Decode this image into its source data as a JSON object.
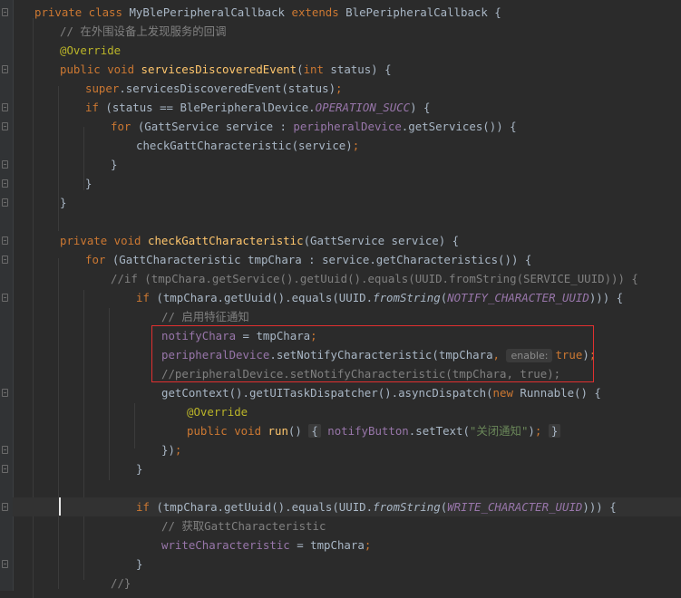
{
  "editor": {
    "lines": [
      {
        "indent": 24,
        "segments": [
          [
            "kw",
            "private class "
          ],
          [
            "",
            "MyBlePeripheralCallback "
          ],
          [
            "kw",
            "extends "
          ],
          [
            "",
            "BlePeripheralCallback {"
          ]
        ]
      },
      {
        "indent": 52,
        "segments": [
          [
            "cm",
            "// 在外围设备上发现服务的回调"
          ]
        ]
      },
      {
        "indent": 52,
        "segments": [
          [
            "an",
            "@Override"
          ]
        ]
      },
      {
        "indent": 52,
        "segments": [
          [
            "kw",
            "public void "
          ],
          [
            "fn",
            "servicesDiscoveredEvent"
          ],
          [
            "",
            "("
          ],
          [
            "kw",
            "int "
          ],
          [
            "",
            "status) {"
          ]
        ]
      },
      {
        "indent": 80,
        "segments": [
          [
            "kw",
            "super"
          ],
          [
            "",
            ".servicesDiscoveredEvent(status)"
          ],
          [
            "kw",
            ";"
          ]
        ]
      },
      {
        "indent": 80,
        "segments": [
          [
            "kw",
            "if "
          ],
          [
            "",
            "(status == BlePeripheralDevice."
          ],
          [
            "cst",
            "OPERATION_SUCC"
          ],
          [
            "",
            ") {"
          ]
        ]
      },
      {
        "indent": 108,
        "segments": [
          [
            "kw",
            "for "
          ],
          [
            "",
            "(GattService service : "
          ],
          [
            "fld",
            "peripheralDevice"
          ],
          [
            "",
            ".getServices()) {"
          ]
        ]
      },
      {
        "indent": 136,
        "segments": [
          [
            "",
            "checkGattCharacteristic(service)"
          ],
          [
            "kw",
            ";"
          ]
        ]
      },
      {
        "indent": 108,
        "segments": [
          [
            "",
            "}"
          ]
        ]
      },
      {
        "indent": 80,
        "segments": [
          [
            "",
            "}"
          ]
        ]
      },
      {
        "indent": 52,
        "segments": [
          [
            "",
            "}"
          ]
        ]
      },
      {
        "indent": 0,
        "segments": []
      },
      {
        "indent": 52,
        "segments": [
          [
            "kw",
            "private void "
          ],
          [
            "fn",
            "checkGattCharacteristic"
          ],
          [
            "",
            "(GattService service) {"
          ]
        ]
      },
      {
        "indent": 80,
        "segments": [
          [
            "kw",
            "for "
          ],
          [
            "",
            "(GattCharacteristic tmpChara : service.getCharacteristics()) {"
          ]
        ]
      },
      {
        "indent": 108,
        "segments": [
          [
            "cm",
            "//if (tmpChara.getService().getUuid().equals(UUID.fromString(SERVICE_UUID))) {"
          ]
        ]
      },
      {
        "indent": 136,
        "segments": [
          [
            "kw",
            "if "
          ],
          [
            "",
            "(tmpChara.getUuid().equals(UUID."
          ],
          [
            "it",
            "fromString"
          ],
          [
            "",
            "("
          ],
          [
            "cst",
            "NOTIFY_CHARACTER_UUID"
          ],
          [
            "",
            "))) {"
          ]
        ]
      },
      {
        "indent": 164,
        "segments": [
          [
            "cm",
            "// 启用特征通知"
          ]
        ]
      },
      {
        "indent": 164,
        "segments": [
          [
            "fld",
            "notifyChara "
          ],
          [
            "",
            "= tmpChara"
          ],
          [
            "kw",
            ";"
          ]
        ]
      },
      {
        "indent": 164,
        "segments": [
          [
            "fld",
            "peripheralDevice"
          ],
          [
            "",
            ".setNotifyCharacteristic(tmpChara"
          ],
          [
            "kw",
            ", "
          ],
          [
            "hint",
            "enable:"
          ],
          [
            "kw",
            "true"
          ],
          [
            "",
            ")"
          ],
          [
            "kw",
            ";"
          ]
        ]
      },
      {
        "indent": 164,
        "segments": [
          [
            "cm",
            "//peripheralDevice.setNotifyCharacteristic(tmpChara, true);"
          ]
        ]
      },
      {
        "indent": 164,
        "segments": [
          [
            "",
            "getContext().getUITaskDispatcher().asyncDispatch("
          ],
          [
            "kw",
            "new "
          ],
          [
            "",
            "Runnable() {"
          ]
        ]
      },
      {
        "indent": 192,
        "segments": [
          [
            "an",
            "@Override"
          ]
        ]
      },
      {
        "indent": 192,
        "segments": [
          [
            "kw",
            "public void "
          ],
          [
            "fn",
            "run"
          ],
          [
            "",
            "() "
          ],
          [
            "brace",
            "{"
          ],
          [
            "",
            " "
          ],
          [
            "fld",
            "notifyButton"
          ],
          [
            "",
            ".setText("
          ],
          [
            "st",
            "\"关闭通知\""
          ],
          [
            "",
            ")"
          ],
          [
            "kw",
            ";"
          ],
          [
            "",
            " "
          ],
          [
            "brace",
            "}"
          ]
        ]
      },
      {
        "indent": 164,
        "segments": [
          [
            "",
            "})"
          ],
          [
            "kw",
            ";"
          ]
        ]
      },
      {
        "indent": 136,
        "segments": [
          [
            "",
            "}"
          ]
        ]
      },
      {
        "indent": 0,
        "segments": []
      },
      {
        "indent": 136,
        "segments": [
          [
            "kw",
            "if "
          ],
          [
            "",
            "(tmpChara.getUuid().equals(UUID."
          ],
          [
            "it",
            "fromString"
          ],
          [
            "",
            "("
          ],
          [
            "cst",
            "WRITE_CHARACTER_UUID"
          ],
          [
            "",
            "))) {"
          ]
        ]
      },
      {
        "indent": 164,
        "segments": [
          [
            "cm",
            "// 获取GattCharacteristic"
          ]
        ]
      },
      {
        "indent": 164,
        "segments": [
          [
            "fld",
            "writeCharacteristic "
          ],
          [
            "",
            "= tmpChara"
          ],
          [
            "kw",
            ";"
          ]
        ]
      },
      {
        "indent": 136,
        "segments": [
          [
            "",
            "}"
          ]
        ]
      },
      {
        "indent": 108,
        "segments": [
          [
            "cm",
            "//}"
          ]
        ]
      }
    ]
  },
  "colors": {
    "background": "#2b2b2b",
    "keyword": "#cc7832",
    "function": "#ffc66d",
    "comment": "#808080",
    "annotation": "#bbb529",
    "string": "#6a8759",
    "field": "#9876aa",
    "highlight_box": "#e03030"
  }
}
